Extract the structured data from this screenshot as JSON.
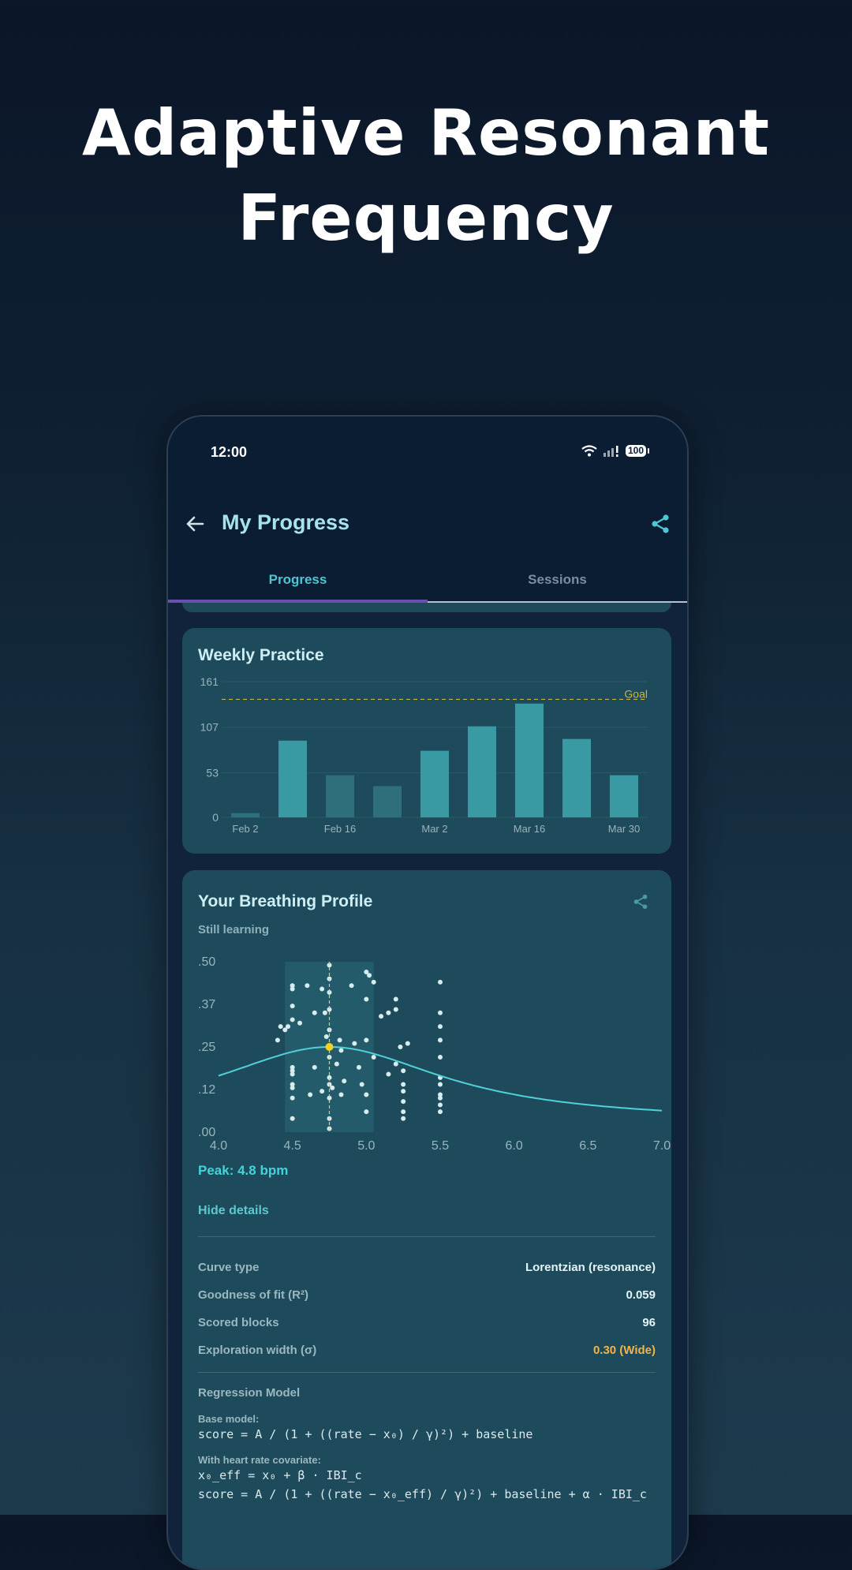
{
  "hero": {
    "title_line1": "Adaptive Resonant",
    "title_line2": "Frequency"
  },
  "status_bar": {
    "time": "12:00",
    "battery": "100"
  },
  "appbar": {
    "title": "My Progress"
  },
  "tabs": [
    {
      "label": "Progress",
      "active": true
    },
    {
      "label": "Sessions",
      "active": false
    }
  ],
  "weekly_practice": {
    "title": "Weekly Practice",
    "goal_label": "Goal",
    "y_ticks": [
      "0",
      "53",
      "107",
      "161"
    ],
    "x_ticks": [
      "Feb 2",
      "Feb 16",
      "Mar 2",
      "Mar 16",
      "Mar 30"
    ],
    "chart_data": {
      "type": "bar",
      "values": [
        5,
        91,
        50,
        37,
        79,
        108,
        135,
        93,
        50
      ],
      "tick_labels": [
        "Feb 2",
        "Feb 16",
        "Mar 2",
        "Mar 16",
        "Mar 30"
      ],
      "ylim": [
        0,
        161
      ],
      "goal": 140,
      "grid": true,
      "colors": {
        "bar": "#3a9aa3",
        "bar_dim": "#2e6f7b",
        "goal": "#c8b43c"
      }
    }
  },
  "breathing_profile": {
    "title": "Your Breathing Profile",
    "status": "Still learning",
    "peak": "Peak: 4.8 bpm",
    "hide_details": "Hide details",
    "y_tick_labels": [
      ".00",
      ".12",
      ".25",
      ".37",
      ".50"
    ],
    "x_tick_labels": [
      "4.0",
      "4.5",
      "5.0",
      "5.5",
      "6.0",
      "6.5",
      "7.0"
    ],
    "chart_data": {
      "type": "scatter",
      "xlim": [
        4.0,
        7.0
      ],
      "ylim": [
        0.0,
        0.5
      ],
      "peak_x": 4.75,
      "peak_y": 0.25,
      "band": [
        4.45,
        5.05
      ],
      "curve": {
        "type": "lorentzian",
        "x0": 4.75,
        "gamma": 0.95,
        "amplitude": 0.22,
        "baseline": 0.03
      },
      "points": [
        [
          4.4,
          0.27
        ],
        [
          4.42,
          0.31
        ],
        [
          4.45,
          0.3
        ],
        [
          4.47,
          0.31
        ],
        [
          4.5,
          0.43
        ],
        [
          4.5,
          0.42
        ],
        [
          4.5,
          0.37
        ],
        [
          4.5,
          0.33
        ],
        [
          4.5,
          0.19
        ],
        [
          4.5,
          0.18
        ],
        [
          4.5,
          0.17
        ],
        [
          4.5,
          0.14
        ],
        [
          4.5,
          0.13
        ],
        [
          4.5,
          0.1
        ],
        [
          4.5,
          0.04
        ],
        [
          4.55,
          0.32
        ],
        [
          4.6,
          0.43
        ],
        [
          4.62,
          0.11
        ],
        [
          4.65,
          0.19
        ],
        [
          4.65,
          0.35
        ],
        [
          4.7,
          0.42
        ],
        [
          4.7,
          0.12
        ],
        [
          4.72,
          0.35
        ],
        [
          4.73,
          0.28
        ],
        [
          4.75,
          0.49
        ],
        [
          4.75,
          0.45
        ],
        [
          4.75,
          0.41
        ],
        [
          4.75,
          0.36
        ],
        [
          4.75,
          0.3
        ],
        [
          4.75,
          0.22
        ],
        [
          4.75,
          0.16
        ],
        [
          4.75,
          0.14
        ],
        [
          4.75,
          0.1
        ],
        [
          4.75,
          0.04
        ],
        [
          4.75,
          0.01
        ],
        [
          4.77,
          0.13
        ],
        [
          4.8,
          0.2
        ],
        [
          4.82,
          0.27
        ],
        [
          4.83,
          0.24
        ],
        [
          4.83,
          0.11
        ],
        [
          4.85,
          0.15
        ],
        [
          4.9,
          0.43
        ],
        [
          4.92,
          0.26
        ],
        [
          4.95,
          0.19
        ],
        [
          4.97,
          0.14
        ],
        [
          5.0,
          0.47
        ],
        [
          5.0,
          0.39
        ],
        [
          5.0,
          0.27
        ],
        [
          5.0,
          0.11
        ],
        [
          5.0,
          0.06
        ],
        [
          5.02,
          0.46
        ],
        [
          5.05,
          0.44
        ],
        [
          5.05,
          0.22
        ],
        [
          5.1,
          0.34
        ],
        [
          5.15,
          0.35
        ],
        [
          5.15,
          0.17
        ],
        [
          5.2,
          0.36
        ],
        [
          5.2,
          0.39
        ],
        [
          5.2,
          0.2
        ],
        [
          5.23,
          0.25
        ],
        [
          5.25,
          0.18
        ],
        [
          5.25,
          0.14
        ],
        [
          5.25,
          0.12
        ],
        [
          5.25,
          0.09
        ],
        [
          5.25,
          0.06
        ],
        [
          5.25,
          0.04
        ],
        [
          5.28,
          0.26
        ],
        [
          5.5,
          0.44
        ],
        [
          5.5,
          0.35
        ],
        [
          5.5,
          0.31
        ],
        [
          5.5,
          0.27
        ],
        [
          5.5,
          0.22
        ],
        [
          5.5,
          0.16
        ],
        [
          5.5,
          0.14
        ],
        [
          5.5,
          0.11
        ],
        [
          5.5,
          0.1
        ],
        [
          5.5,
          0.08
        ],
        [
          5.5,
          0.06
        ]
      ],
      "colors": {
        "point": "#d6ecef",
        "curve": "#4fd1d7",
        "peak": "#f2d024",
        "band": "#245b6a"
      }
    },
    "details": [
      {
        "label": "Curve type",
        "value": "Lorentzian (resonance)",
        "tone": "normal"
      },
      {
        "label": "Goodness of fit (R²)",
        "value": "0.059",
        "tone": "normal"
      },
      {
        "label": "Scored blocks",
        "value": "96",
        "tone": "normal"
      },
      {
        "label": "Exploration width (σ)",
        "value": "0.30 (Wide)",
        "tone": "warn"
      }
    ],
    "regression": {
      "heading": "Regression Model",
      "base_label": "Base model:",
      "base_formula": "score = A / (1 + ((rate − x₀) / γ)²) + baseline",
      "covariate_label": "With heart rate covariate:",
      "cov_formula_1": "x₀_eff = x₀ + β · IBI_c",
      "cov_formula_2": "score = A / (1 + ((rate − x₀_eff) / γ)²) + baseline + α · IBI_c"
    }
  }
}
